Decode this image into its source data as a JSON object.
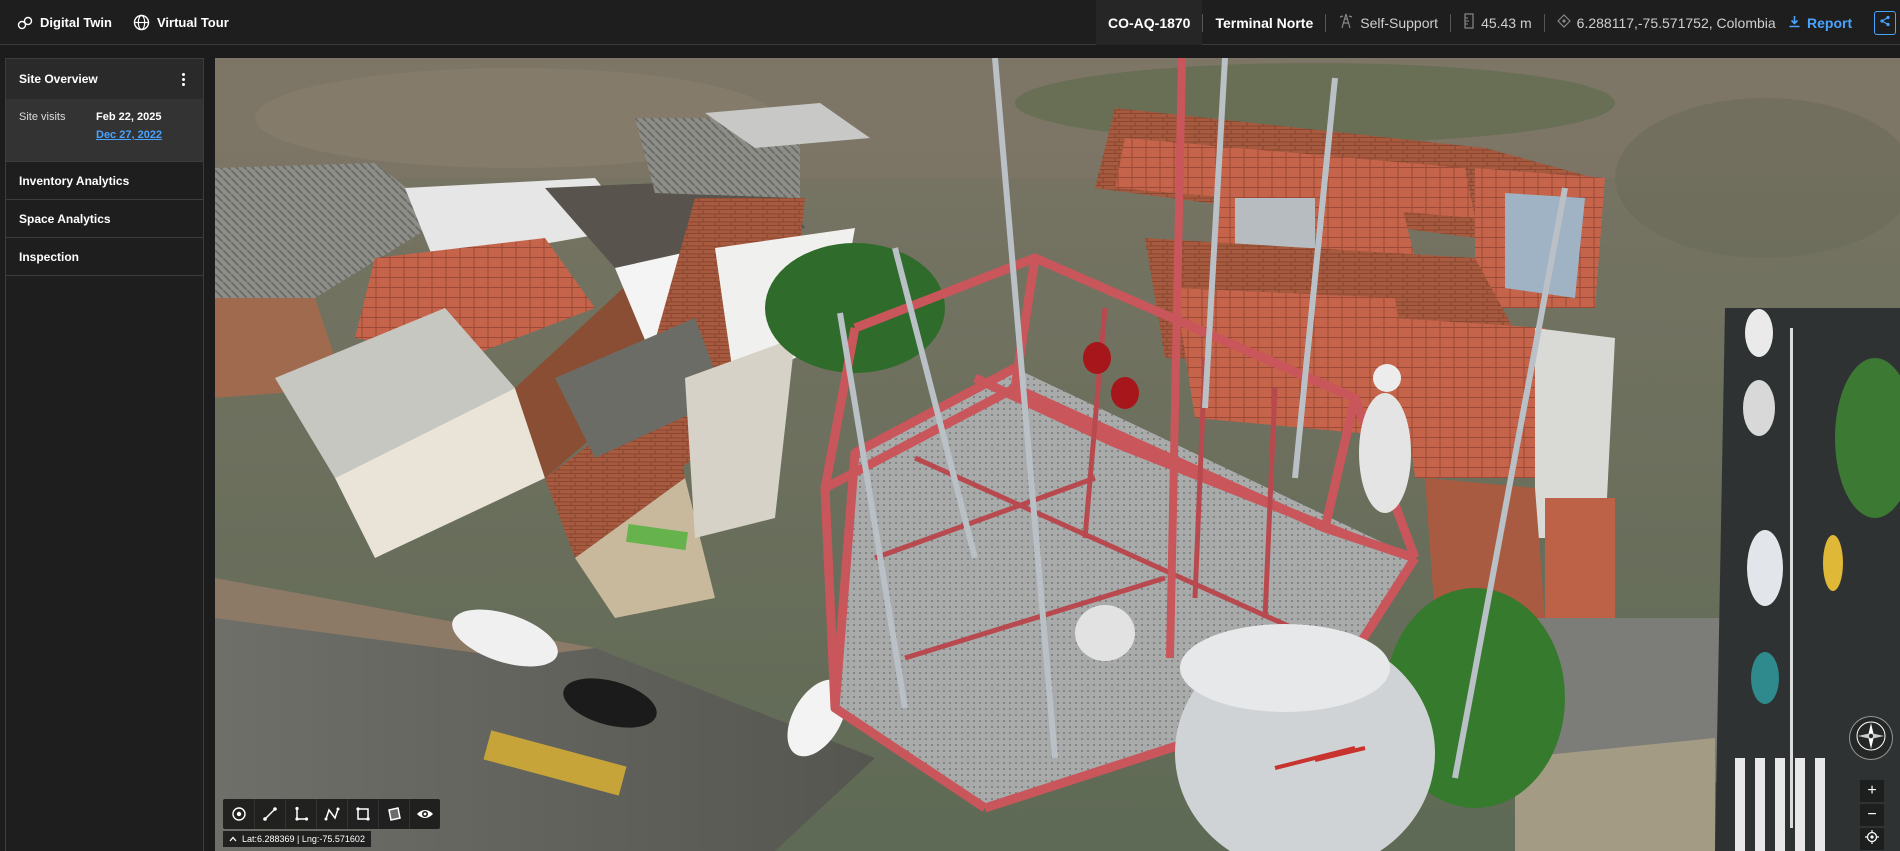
{
  "topbar": {
    "nav": [
      {
        "label": "Digital Twin",
        "icon": "link-icon"
      },
      {
        "label": "Virtual Tour",
        "icon": "globe-icon"
      }
    ],
    "site_id": "CO-AQ-1870",
    "site_name": "Terminal Norte",
    "structure_type": "Self-Support",
    "height": "45.43 m",
    "location": "6.288117,-75.571752, Colombia",
    "report_label": "Report"
  },
  "sidebar": {
    "header": "Site Overview",
    "visits_label": "Site visits",
    "visit_dates": [
      "Feb 22, 2025",
      "Dec 27, 2022"
    ],
    "items": [
      "Inventory Analytics",
      "Space Analytics",
      "Inspection"
    ]
  },
  "viewport": {
    "coords": "Lat:6.288369 | Lng:-75.571602",
    "tools": [
      "point-tool-icon",
      "line-tool-icon",
      "angle-tool-icon",
      "polyline-tool-icon",
      "area-tool-icon",
      "polygon-tool-icon",
      "visibility-eye-icon"
    ],
    "zoom_in": "+",
    "zoom_out": "−"
  },
  "colors": {
    "accent": "#4aa3ff",
    "background": "#1c1c1c",
    "tower_red": "#c9565a"
  }
}
